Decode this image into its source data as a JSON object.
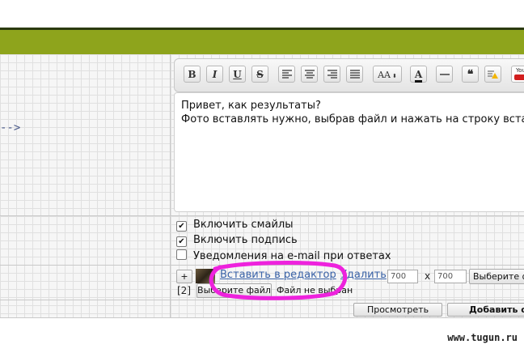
{
  "toolbar": {
    "bold": "B",
    "italic": "I",
    "underline": "U",
    "strike": "S",
    "font_size": "AA",
    "font_color": "A",
    "youtube": "You"
  },
  "left": {
    "arrow_text": "-->"
  },
  "editor": {
    "line1": "Привет, как результаты?",
    "line2": "Фото вставлять нужно, выбрав файл и нажать на строку вставить в редактор"
  },
  "options": {
    "smiles": {
      "label": "Включить смайлы",
      "checked": true
    },
    "signature": {
      "label": "Включить подпись",
      "checked": true
    },
    "notify": {
      "label": "Уведомления на e-mail при ответах",
      "checked": false
    }
  },
  "attach": {
    "add_label": "+",
    "insert_link": "Вставить в редактор",
    "delete_link": "Удалить",
    "width": "700",
    "x_sep": "x",
    "height": "700",
    "choose_btn_right": "Выберите файл",
    "index": "[2]",
    "choose_btn": "Выберите файл",
    "no_file": "Файл не выбран",
    "highlight_color": "#ee22dd"
  },
  "actions": {
    "preview": "Просмотреть",
    "submit": "Добавить ответ"
  },
  "watermark": "www.tugun.ru"
}
